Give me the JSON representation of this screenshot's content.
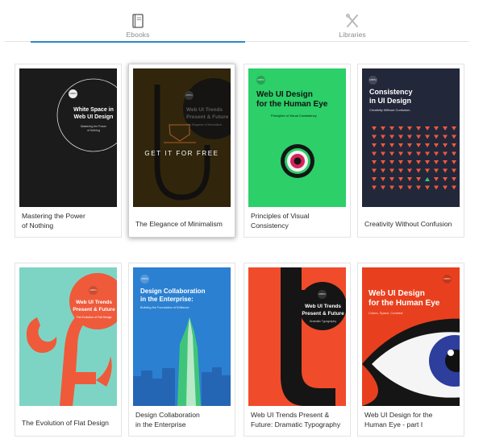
{
  "tabs": [
    {
      "label": "Ebooks",
      "active": true
    },
    {
      "label": "Libraries",
      "active": false
    }
  ],
  "accent_color": "#2d89c5",
  "books": [
    {
      "title_line1": "Mastering the Power",
      "title_line2": "of Nothing",
      "cover": {
        "badge": "UXPin",
        "heading_line1": "White Space in",
        "heading_line2": "Web UI Design",
        "sub_line1": "Mastering the Power",
        "sub_line2": "of Nothing",
        "bg": "#1a1a1a"
      }
    },
    {
      "title_line1": "The Elegance of Minimalism",
      "hovered": true,
      "cover": {
        "badge": "UXPin",
        "heading_line1": "Web UI Trends",
        "heading_line2": "Present & Future",
        "sub_line1": "The Elegance of Minimalism",
        "cta": "GET IT FOR FREE",
        "bg": "#3a2c0c"
      }
    },
    {
      "title_line1": "Principles of Visual",
      "title_line2": "Consistency",
      "cover": {
        "badge": "UXPin",
        "heading_line1": "Web UI Design",
        "heading_line2": "for the Human Eye",
        "sub_line1": "Principles of Visual Consistency",
        "bg": "#2cd16a"
      }
    },
    {
      "title_line1": "Creativity Without Confusion",
      "cover": {
        "badge": "UXPin",
        "heading_line1": "Consistency",
        "heading_line2": "in UI Design",
        "sub_line1": "Creativity Without Confusion",
        "bg": "#22263a"
      }
    },
    {
      "title_line1": "The Evolution of Flat Design",
      "cover": {
        "badge": "UXPin",
        "heading_line1": "Web UI Trends",
        "heading_line2": "Present & Future",
        "sub_line1": "The Evolution of Flat Design",
        "bg": "#7fd3c4"
      }
    },
    {
      "title_line1": "Design Collaboration",
      "title_line2": "in the Enterprise",
      "cover": {
        "badge": "UXPin",
        "heading_line1": "Design Collaboration",
        "heading_line2": "in the Enterprise:",
        "sub_line1": "Building the Foundation of Brilliance",
        "bg": "#2b7fd0"
      }
    },
    {
      "title_line1": "Web UI Trends Present &",
      "title_line2": "Future: Dramatic Typography",
      "cover": {
        "badge": "UXPin",
        "heading_line1": "Web UI Trends",
        "heading_line2": "Present & Future",
        "sub_line1": "Dramatic Typography",
        "bg": "#f04a2c"
      }
    },
    {
      "title_line1": "Web UI Design for the",
      "title_line2": "Human Eye - part I",
      "cover": {
        "badge": "UXPin",
        "heading_line1": "Web UI Design",
        "heading_line2": "for the Human Eye",
        "sub_line1": "Colors, Space, Contrast",
        "bg": "#e8401e"
      }
    }
  ]
}
